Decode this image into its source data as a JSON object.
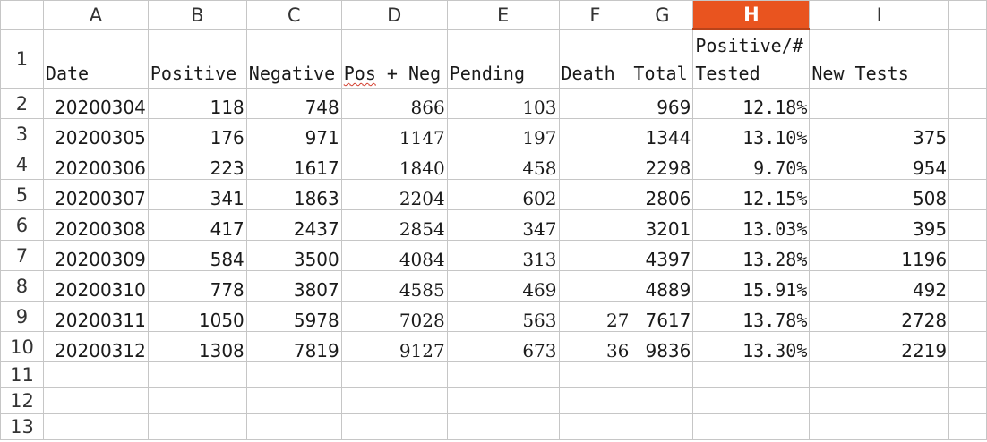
{
  "sheet": {
    "columns": [
      "A",
      "B",
      "C",
      "D",
      "E",
      "F",
      "G",
      "H",
      "I"
    ],
    "active_column": "H",
    "header_row": {
      "row": "1",
      "A": "Date",
      "B": "Positive",
      "C": "Negative",
      "D_part1": "Pos",
      "D_part2": " + Neg",
      "E": "Pending",
      "F": "Death",
      "G": "Total",
      "H_line1": "Positive/#",
      "H_line2": "Tested",
      "I": "New Tests"
    },
    "rows": [
      {
        "row": "2",
        "date": "20200304",
        "positive": "118",
        "negative": "748",
        "pos_neg": "866",
        "pending": "103",
        "death": "",
        "total": "969",
        "pct": "12.18%",
        "new_tests": ""
      },
      {
        "row": "3",
        "date": "20200305",
        "positive": "176",
        "negative": "971",
        "pos_neg": "1147",
        "pending": "197",
        "death": "",
        "total": "1344",
        "pct": "13.10%",
        "new_tests": "375"
      },
      {
        "row": "4",
        "date": "20200306",
        "positive": "223",
        "negative": "1617",
        "pos_neg": "1840",
        "pending": "458",
        "death": "",
        "total": "2298",
        "pct": "9.70%",
        "new_tests": "954"
      },
      {
        "row": "5",
        "date": "20200307",
        "positive": "341",
        "negative": "1863",
        "pos_neg": "2204",
        "pending": "602",
        "death": "",
        "total": "2806",
        "pct": "12.15%",
        "new_tests": "508"
      },
      {
        "row": "6",
        "date": "20200308",
        "positive": "417",
        "negative": "2437",
        "pos_neg": "2854",
        "pending": "347",
        "death": "",
        "total": "3201",
        "pct": "13.03%",
        "new_tests": "395"
      },
      {
        "row": "7",
        "date": "20200309",
        "positive": "584",
        "negative": "3500",
        "pos_neg": "4084",
        "pending": "313",
        "death": "",
        "total": "4397",
        "pct": "13.28%",
        "new_tests": "1196"
      },
      {
        "row": "8",
        "date": "20200310",
        "positive": "778",
        "negative": "3807",
        "pos_neg": "4585",
        "pending": "469",
        "death": "",
        "total": "4889",
        "pct": "15.91%",
        "new_tests": "492"
      },
      {
        "row": "9",
        "date": "20200311",
        "positive": "1050",
        "negative": "5978",
        "pos_neg": "7028",
        "pending": "563",
        "death": "27",
        "total": "7617",
        "pct": "13.78%",
        "new_tests": "2728"
      },
      {
        "row": "10",
        "date": "20200312",
        "positive": "1308",
        "negative": "7819",
        "pos_neg": "9127",
        "pending": "673",
        "death": "36",
        "total": "9836",
        "pct": "13.30%",
        "new_tests": "2219"
      }
    ],
    "empty_rows": [
      "11",
      "12",
      "13"
    ]
  }
}
